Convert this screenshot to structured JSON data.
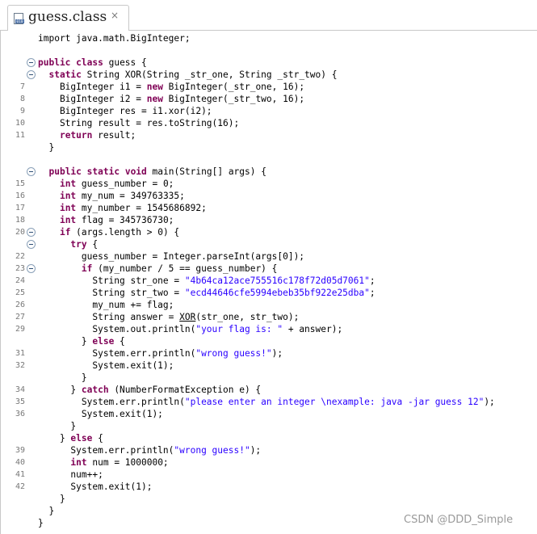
{
  "tab": {
    "title": "guess.class",
    "close_glyph": "×"
  },
  "watermark": "CSDN @DDD_Simple",
  "lines": [
    {
      "n": "",
      "fold": false,
      "tokens": [
        {
          "t": "import java.math.BigInteger;"
        }
      ]
    },
    {
      "n": "",
      "fold": false,
      "tokens": []
    },
    {
      "n": "",
      "fold": true,
      "tokens": [
        {
          "t": "public",
          "c": "kw"
        },
        {
          "t": " "
        },
        {
          "t": "class",
          "c": "kw"
        },
        {
          "t": " guess {"
        }
      ]
    },
    {
      "n": "",
      "fold": true,
      "tokens": [
        {
          "t": "  "
        },
        {
          "t": "static",
          "c": "kw"
        },
        {
          "t": " String XOR(String _str_one, String _str_two) {"
        }
      ]
    },
    {
      "n": "7",
      "fold": false,
      "tokens": [
        {
          "t": "    BigInteger i1 = "
        },
        {
          "t": "new",
          "c": "kw"
        },
        {
          "t": " BigInteger(_str_one, 16);"
        }
      ]
    },
    {
      "n": "8",
      "fold": false,
      "tokens": [
        {
          "t": "    BigInteger i2 = "
        },
        {
          "t": "new",
          "c": "kw"
        },
        {
          "t": " BigInteger(_str_two, 16);"
        }
      ]
    },
    {
      "n": "9",
      "fold": false,
      "tokens": [
        {
          "t": "    BigInteger res = i1.xor(i2);"
        }
      ]
    },
    {
      "n": "10",
      "fold": false,
      "tokens": [
        {
          "t": "    String result = res.toString(16);"
        }
      ]
    },
    {
      "n": "11",
      "fold": false,
      "tokens": [
        {
          "t": "    "
        },
        {
          "t": "return",
          "c": "kw"
        },
        {
          "t": " result;"
        }
      ]
    },
    {
      "n": "",
      "fold": false,
      "tokens": [
        {
          "t": "  }"
        }
      ]
    },
    {
      "n": "",
      "fold": false,
      "tokens": []
    },
    {
      "n": "",
      "fold": true,
      "tokens": [
        {
          "t": "  "
        },
        {
          "t": "public",
          "c": "kw"
        },
        {
          "t": " "
        },
        {
          "t": "static",
          "c": "kw"
        },
        {
          "t": " "
        },
        {
          "t": "void",
          "c": "kw"
        },
        {
          "t": " main(String[] args) {"
        }
      ]
    },
    {
      "n": "15",
      "fold": false,
      "tokens": [
        {
          "t": "    "
        },
        {
          "t": "int",
          "c": "kw"
        },
        {
          "t": " guess_number = 0;"
        }
      ]
    },
    {
      "n": "16",
      "fold": false,
      "tokens": [
        {
          "t": "    "
        },
        {
          "t": "int",
          "c": "kw"
        },
        {
          "t": " my_num = 349763335;"
        }
      ]
    },
    {
      "n": "17",
      "fold": false,
      "tokens": [
        {
          "t": "    "
        },
        {
          "t": "int",
          "c": "kw"
        },
        {
          "t": " my_number = 1545686892;"
        }
      ]
    },
    {
      "n": "18",
      "fold": false,
      "tokens": [
        {
          "t": "    "
        },
        {
          "t": "int",
          "c": "kw"
        },
        {
          "t": " flag = 345736730;"
        }
      ]
    },
    {
      "n": "20",
      "fold": true,
      "tokens": [
        {
          "t": "    "
        },
        {
          "t": "if",
          "c": "kw"
        },
        {
          "t": " (args.length > 0) {"
        }
      ]
    },
    {
      "n": "",
      "fold": true,
      "tokens": [
        {
          "t": "      "
        },
        {
          "t": "try",
          "c": "kw"
        },
        {
          "t": " {"
        }
      ]
    },
    {
      "n": "22",
      "fold": false,
      "tokens": [
        {
          "t": "        guess_number = Integer.parseInt(args[0]);"
        }
      ]
    },
    {
      "n": "23",
      "fold": true,
      "tokens": [
        {
          "t": "        "
        },
        {
          "t": "if",
          "c": "kw"
        },
        {
          "t": " (my_number / 5 == guess_number) {"
        }
      ]
    },
    {
      "n": "24",
      "fold": false,
      "tokens": [
        {
          "t": "          String str_one = "
        },
        {
          "t": "\"4b64ca12ace755516c178f72d05d7061\"",
          "c": "str"
        },
        {
          "t": ";"
        }
      ]
    },
    {
      "n": "25",
      "fold": false,
      "tokens": [
        {
          "t": "          String str_two = "
        },
        {
          "t": "\"ecd44646cfe5994ebeb35bf922e25dba\"",
          "c": "str"
        },
        {
          "t": ";"
        }
      ]
    },
    {
      "n": "26",
      "fold": false,
      "tokens": [
        {
          "t": "          my_num += flag;"
        }
      ]
    },
    {
      "n": "27",
      "fold": false,
      "tokens": [
        {
          "t": "          String answer = "
        },
        {
          "t": "XOR",
          "c": "ul"
        },
        {
          "t": "(str_one, str_two);"
        }
      ]
    },
    {
      "n": "29",
      "fold": false,
      "tokens": [
        {
          "t": "          System.out.println("
        },
        {
          "t": "\"your flag is: \"",
          "c": "str"
        },
        {
          "t": " + answer);"
        }
      ]
    },
    {
      "n": "",
      "fold": false,
      "tokens": [
        {
          "t": "        } "
        },
        {
          "t": "else",
          "c": "kw"
        },
        {
          "t": " {"
        }
      ]
    },
    {
      "n": "31",
      "fold": false,
      "tokens": [
        {
          "t": "          System.err.println("
        },
        {
          "t": "\"wrong guess!\"",
          "c": "str"
        },
        {
          "t": ");"
        }
      ]
    },
    {
      "n": "32",
      "fold": false,
      "tokens": [
        {
          "t": "          System.exit(1);"
        }
      ]
    },
    {
      "n": "",
      "fold": false,
      "tokens": [
        {
          "t": "        }"
        }
      ]
    },
    {
      "n": "34",
      "fold": false,
      "tokens": [
        {
          "t": "      } "
        },
        {
          "t": "catch",
          "c": "kw"
        },
        {
          "t": " (NumberFormatException e) {"
        }
      ]
    },
    {
      "n": "35",
      "fold": false,
      "tokens": [
        {
          "t": "        System.err.println("
        },
        {
          "t": "\"please enter an integer \\nexample: java -jar guess 12\"",
          "c": "str"
        },
        {
          "t": ");"
        }
      ]
    },
    {
      "n": "36",
      "fold": false,
      "tokens": [
        {
          "t": "        System.exit(1);"
        }
      ]
    },
    {
      "n": "",
      "fold": false,
      "tokens": [
        {
          "t": "      }"
        }
      ]
    },
    {
      "n": "",
      "fold": false,
      "tokens": [
        {
          "t": "    } "
        },
        {
          "t": "else",
          "c": "kw"
        },
        {
          "t": " {"
        }
      ]
    },
    {
      "n": "39",
      "fold": false,
      "tokens": [
        {
          "t": "      System.err.println("
        },
        {
          "t": "\"wrong guess!\"",
          "c": "str"
        },
        {
          "t": ");"
        }
      ]
    },
    {
      "n": "40",
      "fold": false,
      "tokens": [
        {
          "t": "      "
        },
        {
          "t": "int",
          "c": "kw"
        },
        {
          "t": " num = 1000000;"
        }
      ]
    },
    {
      "n": "41",
      "fold": false,
      "tokens": [
        {
          "t": "      num++;"
        }
      ]
    },
    {
      "n": "42",
      "fold": false,
      "tokens": [
        {
          "t": "      System.exit(1);"
        }
      ]
    },
    {
      "n": "",
      "fold": false,
      "tokens": [
        {
          "t": "    }"
        }
      ]
    },
    {
      "n": "",
      "fold": false,
      "tokens": [
        {
          "t": "  }"
        }
      ]
    },
    {
      "n": "",
      "fold": false,
      "tokens": [
        {
          "t": "}"
        }
      ]
    }
  ]
}
